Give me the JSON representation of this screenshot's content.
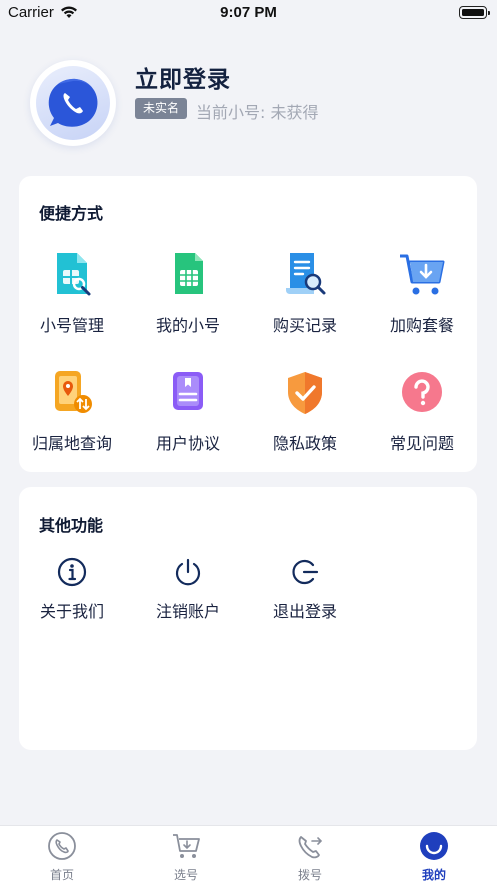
{
  "status_bar": {
    "carrier": "Carrier",
    "time": "9:07 PM"
  },
  "profile": {
    "login_title": "立即登录",
    "realname_badge": "未实名",
    "number_status": "当前小号: 未获得"
  },
  "shortcuts": {
    "title": "便捷方式",
    "items": [
      {
        "label": "小号管理",
        "icon": "sim-manage-icon"
      },
      {
        "label": "我的小号",
        "icon": "sim-card-icon"
      },
      {
        "label": "购买记录",
        "icon": "purchase-record-icon"
      },
      {
        "label": "加购套餐",
        "icon": "cart-add-icon"
      },
      {
        "label": "归属地查询",
        "icon": "location-query-icon"
      },
      {
        "label": "用户协议",
        "icon": "agreement-icon"
      },
      {
        "label": "隐私政策",
        "icon": "shield-check-icon"
      },
      {
        "label": "常见问题",
        "icon": "question-icon"
      }
    ]
  },
  "others": {
    "title": "其他功能",
    "items": [
      {
        "label": "关于我们",
        "icon": "info-icon"
      },
      {
        "label": "注销账户",
        "icon": "power-icon"
      },
      {
        "label": "退出登录",
        "icon": "logout-icon"
      }
    ]
  },
  "tab_bar": {
    "tabs": [
      {
        "label": "首页",
        "icon": "home-phone-icon"
      },
      {
        "label": "选号",
        "icon": "cart-icon"
      },
      {
        "label": "拨号",
        "icon": "dial-icon"
      },
      {
        "label": "我的",
        "icon": "profile-smile-icon"
      }
    ],
    "active": "我的"
  },
  "colors": {
    "accent": "#1f3fbd",
    "background": "#f2f3f7",
    "badge": "#7b8496"
  }
}
